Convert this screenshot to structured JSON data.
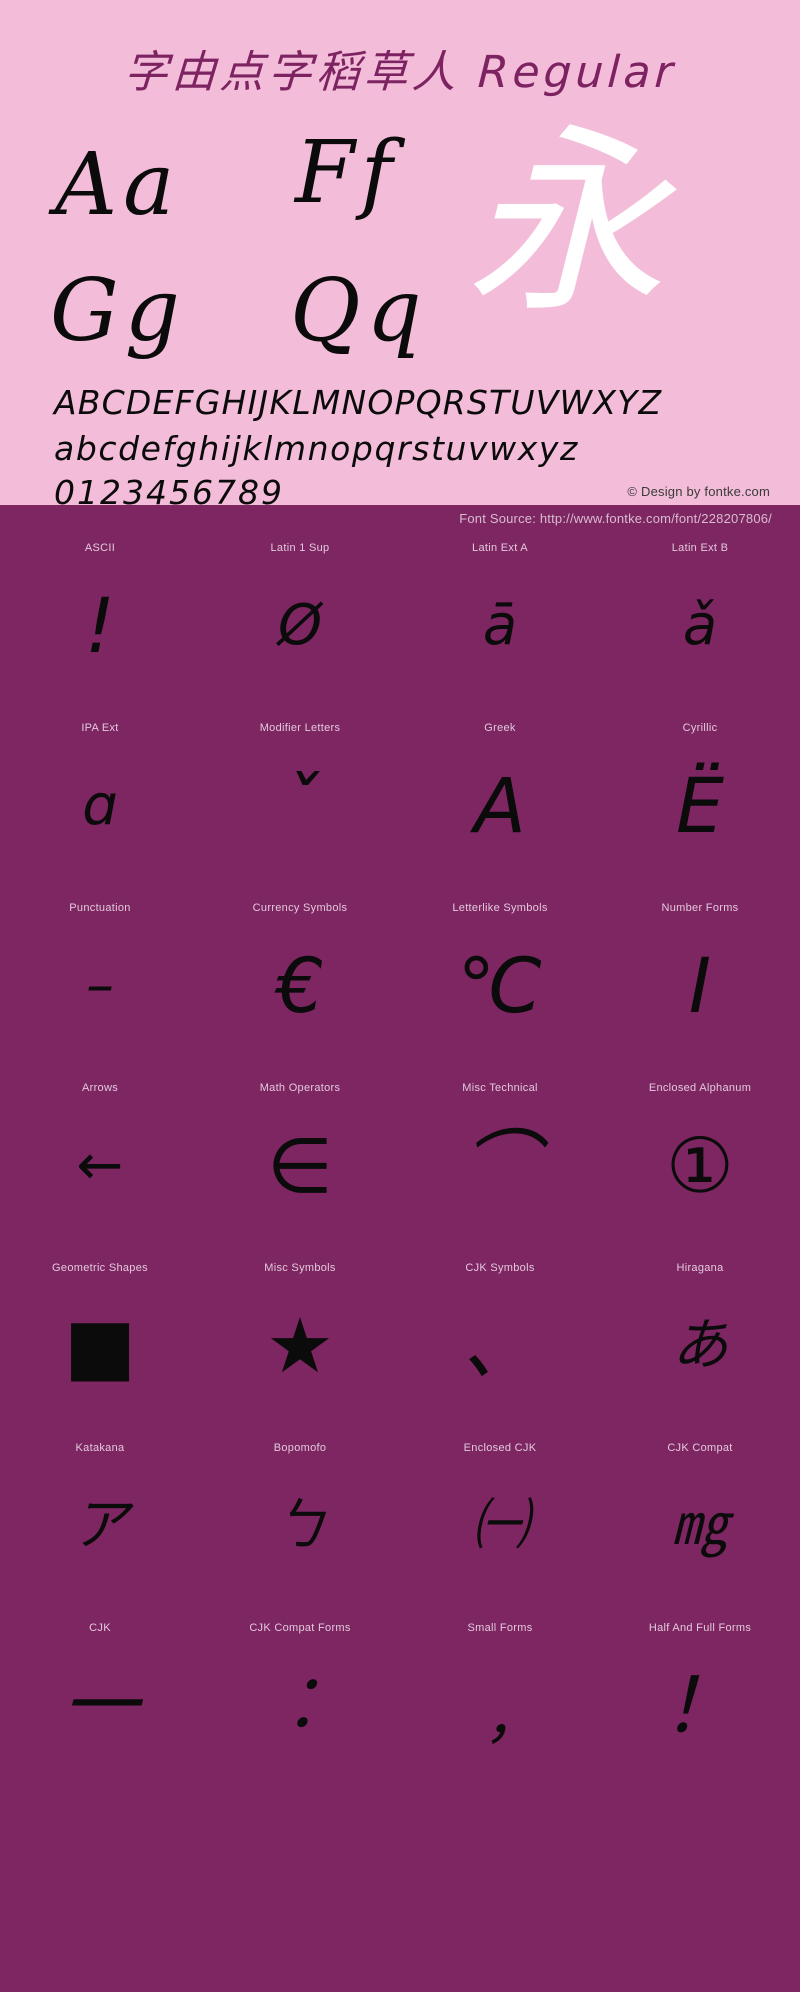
{
  "specimen": {
    "title": "字由点字稻草人  Regular",
    "big_samples": [
      {
        "name": "sample-aa",
        "text": "Aa"
      },
      {
        "name": "sample-ff",
        "text": "Ff"
      },
      {
        "name": "sample-gg",
        "text": "Gg"
      },
      {
        "name": "sample-qq",
        "text": "Qq"
      }
    ],
    "cjk_sample": "永",
    "alphabet": {
      "uppercase": "ABCDEFGHIJKLMNOPQRSTUVWXYZ",
      "lowercase": "abcdefghijklmnopqrstuvwxyz",
      "digits": "0123456789"
    },
    "copyright": "© Design by fontke.com",
    "source": "Font Source: http://www.fontke.com/font/228207806/"
  },
  "colors": {
    "header_bg": "#f3bcd9",
    "grid_bg": "#7d2662",
    "title_color": "#7d2361",
    "label_color": "#e3c9dd",
    "glyph_color": "#0b0b0b",
    "cjk_sample_color": "#ffffff",
    "source_text_color": "#d9bcd0"
  },
  "grid": {
    "rows": [
      [
        {
          "label": "ASCII",
          "glyph": "!",
          "size": "lg"
        },
        {
          "label": "Latin 1 Sup",
          "glyph": "Ø",
          "size": "md"
        },
        {
          "label": "Latin Ext A",
          "glyph": "ā",
          "size": "md"
        },
        {
          "label": "Latin Ext B",
          "glyph": "ǎ",
          "size": "md"
        }
      ],
      [
        {
          "label": "IPA Ext",
          "glyph": "ɑ",
          "size": "md"
        },
        {
          "label": "Modifier Letters",
          "glyph": "ˇ",
          "size": "lg"
        },
        {
          "label": "Greek",
          "glyph": "Α",
          "size": "lg"
        },
        {
          "label": "Cyrillic",
          "glyph": "Ë",
          "size": "lg"
        }
      ],
      [
        {
          "label": "Punctuation",
          "glyph": "–",
          "size": "md"
        },
        {
          "label": "Currency Symbols",
          "glyph": "€",
          "size": "lg"
        },
        {
          "label": "Letterlike Symbols",
          "glyph": "℃",
          "size": "lg"
        },
        {
          "label": "Number Forms",
          "glyph": "Ⅰ",
          "size": "lg"
        }
      ],
      [
        {
          "label": "Arrows",
          "glyph": "←",
          "size": "md"
        },
        {
          "label": "Math Operators",
          "glyph": "∈",
          "size": "lg"
        },
        {
          "label": "Misc Technical",
          "glyph": "⌒",
          "size": "lg"
        },
        {
          "label": "Enclosed Alphanum",
          "glyph": "①",
          "size": "lg"
        }
      ],
      [
        {
          "label": "Geometric Shapes",
          "glyph": "■",
          "size": "lg"
        },
        {
          "label": "Misc Symbols",
          "glyph": "★",
          "size": "lg"
        },
        {
          "label": "CJK Symbols",
          "glyph": "、",
          "size": "lg"
        },
        {
          "label": "Hiragana",
          "glyph": "あ",
          "size": "md"
        }
      ],
      [
        {
          "label": "Katakana",
          "glyph": "ア",
          "size": "md"
        },
        {
          "label": "Bopomofo",
          "glyph": "ㄅ",
          "size": "md"
        },
        {
          "label": "Enclosed CJK",
          "glyph": "㈠",
          "size": "md"
        },
        {
          "label": "CJK Compat",
          "glyph": "㎎",
          "size": "md"
        }
      ],
      [
        {
          "label": "CJK",
          "glyph": "一",
          "size": "lg"
        },
        {
          "label": "CJK Compat Forms",
          "glyph": "︰",
          "size": "lg"
        },
        {
          "label": "Small Forms",
          "glyph": "﹐",
          "size": "lg"
        },
        {
          "label": "Half And Full Forms",
          "glyph": "！",
          "size": "lg"
        }
      ]
    ]
  }
}
